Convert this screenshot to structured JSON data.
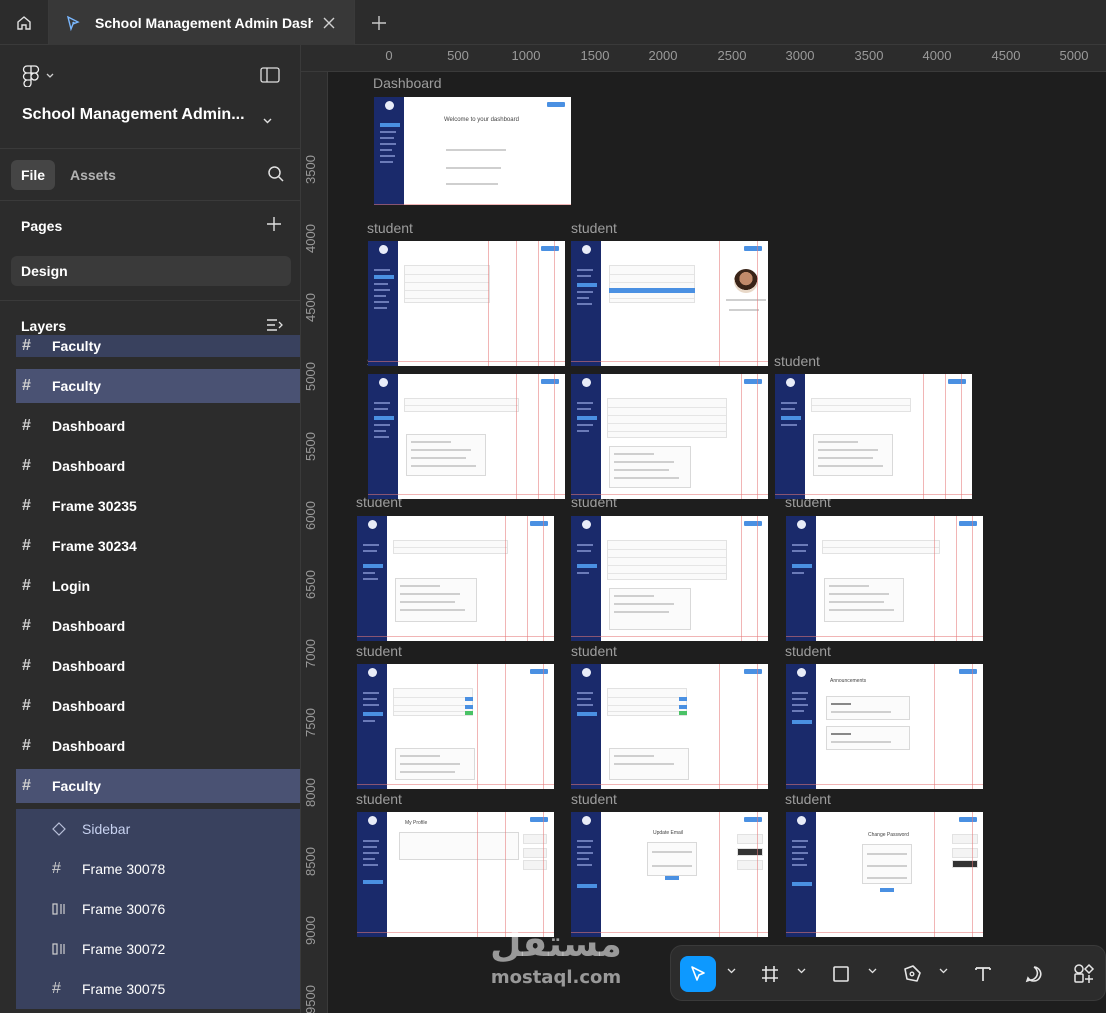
{
  "tab": {
    "title": "School Management Admin Dash"
  },
  "left_panel": {
    "project_title": "School Management Admin...",
    "tabs": {
      "file": "File",
      "assets": "Assets"
    },
    "pages_header": "Pages",
    "pages": [
      "Design"
    ],
    "layers_header": "Layers",
    "layers": [
      {
        "label": "Faculty",
        "type": "frame",
        "state": "partial"
      },
      {
        "label": "Faculty",
        "type": "frame",
        "state": "selected"
      },
      {
        "label": "Dashboard",
        "type": "frame"
      },
      {
        "label": "Dashboard",
        "type": "frame"
      },
      {
        "label": "Frame 30235",
        "type": "frame"
      },
      {
        "label": "Frame 30234",
        "type": "frame"
      },
      {
        "label": "Login",
        "type": "frame"
      },
      {
        "label": "Dashboard",
        "type": "frame"
      },
      {
        "label": "Dashboard",
        "type": "frame"
      },
      {
        "label": "Dashboard",
        "type": "frame"
      },
      {
        "label": "Dashboard",
        "type": "frame"
      },
      {
        "label": "Faculty",
        "type": "frame",
        "state": "selected"
      },
      {
        "label": "Sidebar",
        "type": "component",
        "state": "child"
      },
      {
        "label": "Frame 30078",
        "type": "frame",
        "state": "child"
      },
      {
        "label": "Frame 30076",
        "type": "autolayout",
        "state": "child"
      },
      {
        "label": "Frame 30072",
        "type": "autolayout",
        "state": "child"
      },
      {
        "label": "Frame 30075",
        "type": "frame",
        "state": "child"
      }
    ]
  },
  "rulers": {
    "top": [
      "0",
      "500",
      "1000",
      "1500",
      "2000",
      "2500",
      "3000",
      "3500",
      "4000",
      "4500",
      "5000"
    ],
    "left": [
      "3500",
      "4000",
      "4500",
      "5000",
      "5500",
      "6000",
      "6500",
      "7000",
      "7500",
      "8000",
      "8500",
      "9000",
      "9500"
    ]
  },
  "canvas": {
    "frame_labels": {
      "dashboard": "Dashboard",
      "student": "student"
    },
    "frame_texts": {
      "welcome": "Welcome to your dashboard",
      "my_profile": "My Profile",
      "update_email": "Update Email",
      "change_password": "Change Password",
      "announcements": "Announcements"
    }
  },
  "watermark": {
    "arabic": "مستقل",
    "latin": "mostaql.com"
  },
  "colors": {
    "accent": "#0d99ff",
    "selection": "#4a5273",
    "sidebar_navy": "#1a2a6b",
    "guide_red": "#e67878"
  }
}
